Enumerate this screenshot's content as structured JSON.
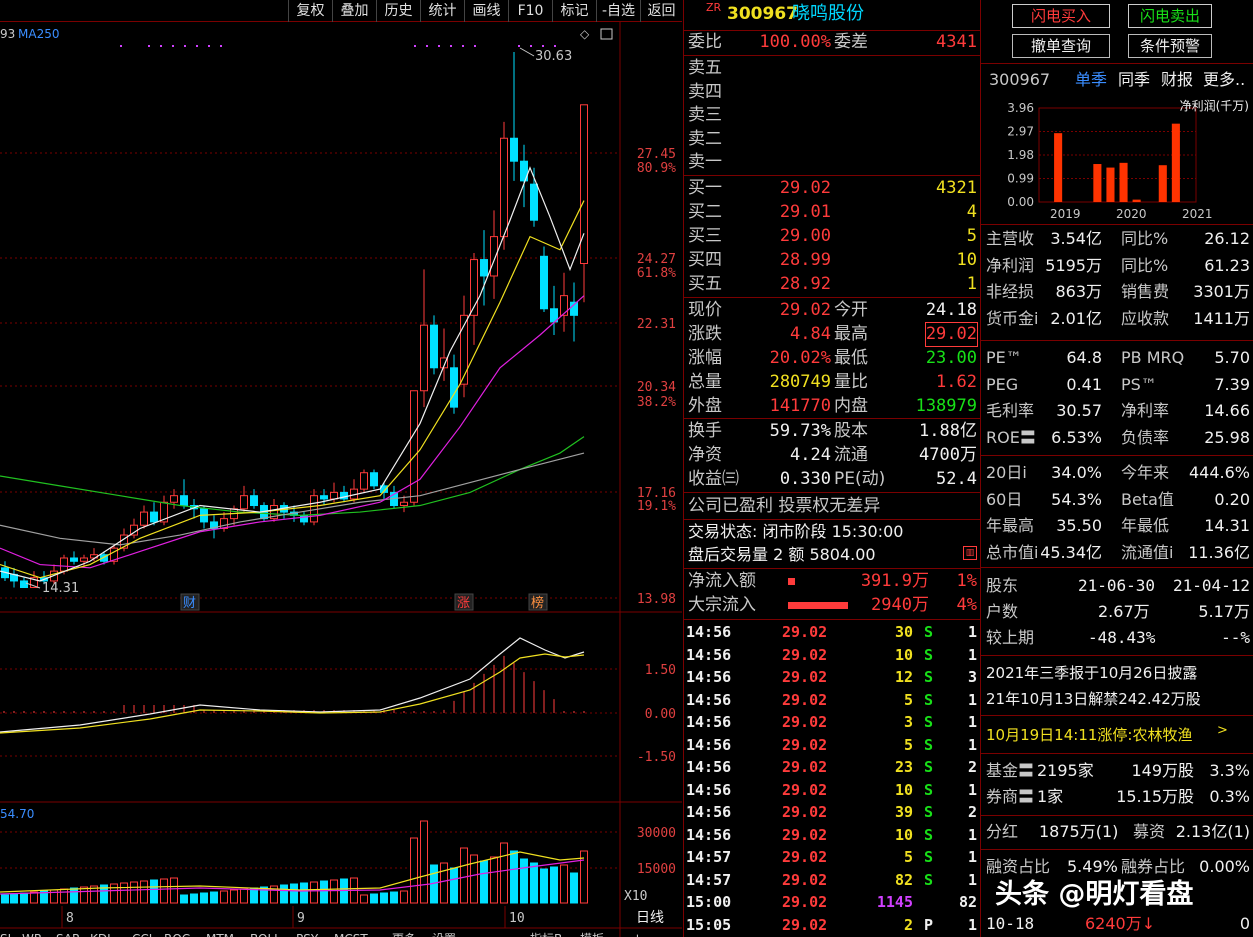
{
  "toolbar": {
    "items": [
      "复权",
      "叠加",
      "历史",
      "统计",
      "画线",
      "F10",
      "标记",
      "-自选",
      "返回"
    ]
  },
  "chart": {
    "ma_label": "MA250",
    "ma_prefix": "93",
    "price_ticks": [
      "27.45",
      "24.27",
      "22.31",
      "20.34",
      "17.16",
      "13.98"
    ],
    "pct_ticks": [
      "80.9%",
      "61.8%",
      "38.2%",
      "19.1%"
    ],
    "high_label": "30.63",
    "low_label": "14.31",
    "markers": [
      "财",
      "涨",
      "榜"
    ],
    "macd_ticks": [
      "1.50",
      "0.00",
      "-1.50"
    ],
    "vol_ticks": [
      "30000",
      "15000",
      "X10"
    ],
    "vol_label": "54.70",
    "date_labels": [
      "8",
      "9",
      "10"
    ],
    "period": "日线",
    "bottom_tabs": [
      "SI",
      "WR",
      "SAR",
      "KDJ",
      "CCI",
      "ROC",
      "MTM",
      "BOLL",
      "PSY",
      "MCST",
      "更多",
      "设置",
      "指标B",
      "模板"
    ]
  },
  "quote": {
    "code_prefix": "ZR",
    "code": "300967",
    "name": "晓鸣股份",
    "weibi_label": "委比",
    "weibi": "100.00%",
    "weicha_label": "委差",
    "weicha": "4341",
    "sells": [
      {
        "label": "卖五"
      },
      {
        "label": "卖四"
      },
      {
        "label": "卖三"
      },
      {
        "label": "卖二"
      },
      {
        "label": "卖一"
      }
    ],
    "buys": [
      {
        "label": "买一",
        "price": "29.02",
        "vol": "4321"
      },
      {
        "label": "买二",
        "price": "29.01",
        "vol": "4"
      },
      {
        "label": "买三",
        "price": "29.00",
        "vol": "5"
      },
      {
        "label": "买四",
        "price": "28.99",
        "vol": "10"
      },
      {
        "label": "买五",
        "price": "28.92",
        "vol": "1"
      }
    ],
    "stats": [
      {
        "l1": "现价",
        "v1": "29.02",
        "l2": "今开",
        "v2": "24.18"
      },
      {
        "l1": "涨跌",
        "v1": "4.84",
        "l2": "最高",
        "v2": "29.02"
      },
      {
        "l1": "涨幅",
        "v1": "20.02%",
        "l2": "最低",
        "v2": "23.00"
      },
      {
        "l1": "总量",
        "v1": "280749",
        "l2": "量比",
        "v2": "1.62"
      },
      {
        "l1": "外盘",
        "v1": "141770",
        "l2": "内盘",
        "v2": "138979"
      }
    ],
    "stats2": [
      {
        "l1": "换手",
        "v1": "59.73%",
        "l2": "股本",
        "v2": "1.88亿"
      },
      {
        "l1": "净资",
        "v1": "4.24",
        "l2": "流通",
        "v2": "4700万"
      },
      {
        "l1": "收益㈢",
        "v1": "0.330",
        "l2": "PE(动)",
        "v2": "52.4"
      }
    ],
    "profit_note": "公司已盈利 投票权无差异",
    "trade_status": "交易状态: 闭市阶段 15:30:00",
    "after_hours": "盘后交易量 2 额 5804.00",
    "netflow_label": "净流入额",
    "netflow": "391.9万",
    "netflow_pct": "1%",
    "block_label": "大宗流入",
    "block": "2940万",
    "block_pct": "4%",
    "ticks": [
      {
        "t": "14:56",
        "p": "29.02",
        "v": "30",
        "s": "S",
        "n": "1"
      },
      {
        "t": "14:56",
        "p": "29.02",
        "v": "10",
        "s": "S",
        "n": "1"
      },
      {
        "t": "14:56",
        "p": "29.02",
        "v": "12",
        "s": "S",
        "n": "3"
      },
      {
        "t": "14:56",
        "p": "29.02",
        "v": "5",
        "s": "S",
        "n": "1"
      },
      {
        "t": "14:56",
        "p": "29.02",
        "v": "3",
        "s": "S",
        "n": "1"
      },
      {
        "t": "14:56",
        "p": "29.02",
        "v": "5",
        "s": "S",
        "n": "1"
      },
      {
        "t": "14:56",
        "p": "29.02",
        "v": "23",
        "s": "S",
        "n": "2"
      },
      {
        "t": "14:56",
        "p": "29.02",
        "v": "10",
        "s": "S",
        "n": "1"
      },
      {
        "t": "14:56",
        "p": "29.02",
        "v": "39",
        "s": "S",
        "n": "2"
      },
      {
        "t": "14:56",
        "p": "29.02",
        "v": "10",
        "s": "S",
        "n": "1"
      },
      {
        "t": "14:57",
        "p": "29.02",
        "v": "5",
        "s": "S",
        "n": "1"
      },
      {
        "t": "14:57",
        "p": "29.02",
        "v": "82",
        "s": "S",
        "n": "1"
      },
      {
        "t": "15:00",
        "p": "29.02",
        "v": "1145",
        "s": "",
        "n": "82"
      },
      {
        "t": "15:05",
        "p": "29.02",
        "v": "2",
        "s": "P",
        "n": "1"
      }
    ]
  },
  "fund": {
    "buttons": [
      "闪电买入",
      "闪电卖出",
      "撤单查询",
      "条件预警"
    ],
    "code": "300967",
    "tabs": [
      "单季",
      "同季",
      "财报",
      "更多.."
    ],
    "mini_title": "净利润(千万)",
    "mini_yticks": [
      "3.96",
      "2.97",
      "1.98",
      "0.99",
      "0.00"
    ],
    "mini_years": [
      "2019",
      "2020",
      "2021"
    ],
    "mini_bars": [
      0,
      2.9,
      0,
      0,
      1.6,
      1.45,
      1.65,
      0.1,
      0,
      1.55,
      3.3,
      0
    ],
    "rows": [
      {
        "l1": "主营收",
        "v1": "3.54亿",
        "l2": "同比%",
        "v2": "26.12"
      },
      {
        "l1": "净利润",
        "v1": "5195万",
        "l2": "同比%",
        "v2": "61.23"
      },
      {
        "l1": "非经损",
        "v1": "863万",
        "l2": "销售费",
        "v2": "3301万"
      },
      {
        "l1": "货币金i",
        "v1": "2.01亿",
        "l2": "应收款",
        "v2": "1411万"
      }
    ],
    "rows2": [
      {
        "l1": "PE™",
        "v1": "64.8",
        "l2": "PB MRQ",
        "v2": "5.70"
      },
      {
        "l1": "PEG",
        "v1": "0.41",
        "l2": "PS™",
        "v2": "7.39"
      },
      {
        "l1": "毛利率",
        "v1": "30.57",
        "l2": "净利率",
        "v2": "14.66"
      },
      {
        "l1": "ROE〓",
        "v1": "6.53%",
        "l2": "负债率",
        "v2": "25.98"
      }
    ],
    "rows3": [
      {
        "l1": "20日i",
        "v1": "34.0%",
        "l2": "今年来",
        "v2": "444.6%"
      },
      {
        "l1": "60日",
        "v1": "54.3%",
        "l2": "Beta值",
        "v2": "0.20"
      },
      {
        "l1": "年最高",
        "v1": "35.50",
        "l2": "年最低",
        "v2": "14.31"
      },
      {
        "l1": "总市值i",
        "v1": "45.34亿",
        "l2": "流通值i",
        "v2": "11.36亿"
      }
    ],
    "holders": {
      "label": "股东",
      "d1": "21-06-30",
      "d2": "21-04-12",
      "count_label": "户数",
      "c1": "2.67万",
      "c2": "5.17万",
      "cmp_label": "较上期",
      "p1": "-48.43%",
      "p2": "--%"
    },
    "notes": [
      "2021年三季报于10月26日披露",
      "21年10月13日解禁242.42万股"
    ],
    "limit_note": "10月19日14:11涨停:农林牧渔",
    "inst": [
      {
        "l": "基金〓",
        "a": "2195家",
        "b": "149万股",
        "c": "3.3%"
      },
      {
        "l": "券商〓",
        "a": "1家",
        "b": "15.15万股",
        "c": "0.3%"
      }
    ],
    "dividend": {
      "l1": "分红",
      "v1": "1875万(1)",
      "l2": "募资",
      "v2": "2.13亿(1)"
    },
    "margin": {
      "l1": "融资占比",
      "v1": "5.49%",
      "l2": "融券占比",
      "v2": "0.00%"
    },
    "last": {
      "date": "10-18",
      "value": "6240万↓",
      "zero": "0"
    }
  },
  "watermark": "头条 @明灯看盘",
  "colors": {
    "up": "#ff3b3b",
    "down": "#00e0ff",
    "grid": "#7a0000"
  }
}
